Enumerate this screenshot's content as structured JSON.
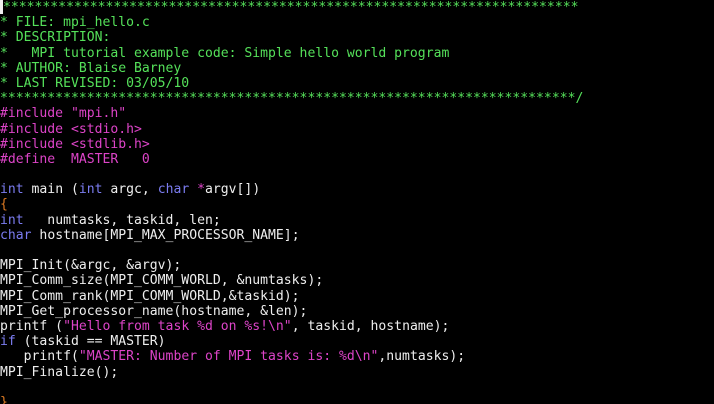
{
  "colors": {
    "background": "#000000",
    "comment": "#55e15a",
    "preprocessor": "#dd44c8",
    "keyword": "#7b7cf0",
    "plain": "#eeeeee",
    "string": "#dd44c8",
    "brace": "#dd7a22",
    "cursor": "#eeeeee"
  },
  "icons": {
    "cursor": "text-cursor-block"
  },
  "editor": {
    "lines": [
      [
        {
          "t": "cursor",
          "s": ""
        },
        {
          "t": "comment",
          "s": "*************************************************************************"
        }
      ],
      [
        {
          "t": "comment",
          "s": "* FILE: mpi_hello.c"
        }
      ],
      [
        {
          "t": "comment",
          "s": "* DESCRIPTION:"
        }
      ],
      [
        {
          "t": "comment",
          "s": "*   MPI tutorial example code: Simple hello world program"
        }
      ],
      [
        {
          "t": "comment",
          "s": "* AUTHOR: Blaise Barney"
        }
      ],
      [
        {
          "t": "comment",
          "s": "* LAST REVISED: 03/05/10"
        }
      ],
      [
        {
          "t": "comment",
          "s": "*************************************************************************/"
        }
      ],
      [
        {
          "t": "preprocessor",
          "s": "#include \"mpi.h\""
        }
      ],
      [
        {
          "t": "preprocessor",
          "s": "#include <stdio.h>"
        }
      ],
      [
        {
          "t": "preprocessor",
          "s": "#include <stdlib.h>"
        }
      ],
      [
        {
          "t": "preprocessor",
          "s": "#define  MASTER   0"
        }
      ],
      [],
      [
        {
          "t": "keyword",
          "s": "int"
        },
        {
          "t": "plain",
          "s": " main ("
        },
        {
          "t": "keyword",
          "s": "int"
        },
        {
          "t": "plain",
          "s": " argc, "
        },
        {
          "t": "keyword",
          "s": "char"
        },
        {
          "t": "plain",
          "s": " "
        },
        {
          "t": "preprocessor",
          "s": "*"
        },
        {
          "t": "plain",
          "s": "argv[])"
        }
      ],
      [
        {
          "t": "brace",
          "s": "{"
        }
      ],
      [
        {
          "t": "keyword",
          "s": "int"
        },
        {
          "t": "plain",
          "s": "   numtasks, taskid, len;"
        }
      ],
      [
        {
          "t": "keyword",
          "s": "char"
        },
        {
          "t": "plain",
          "s": " hostname[MPI_MAX_PROCESSOR_NAME];"
        }
      ],
      [],
      [
        {
          "t": "plain",
          "s": "MPI_Init(&argc, &argv);"
        }
      ],
      [
        {
          "t": "plain",
          "s": "MPI_Comm_size(MPI_COMM_WORLD, &numtasks);"
        }
      ],
      [
        {
          "t": "plain",
          "s": "MPI_Comm_rank(MPI_COMM_WORLD,&taskid);"
        }
      ],
      [
        {
          "t": "plain",
          "s": "MPI_Get_processor_name(hostname, &len);"
        }
      ],
      [
        {
          "t": "plain",
          "s": "printf ("
        },
        {
          "t": "string",
          "s": "\"Hello from task %d on %s!\\n\""
        },
        {
          "t": "plain",
          "s": ", taskid, hostname);"
        }
      ],
      [
        {
          "t": "keyword",
          "s": "if"
        },
        {
          "t": "plain",
          "s": " (taskid == MASTER)"
        }
      ],
      [
        {
          "t": "plain",
          "s": "   printf("
        },
        {
          "t": "string",
          "s": "\"MASTER: Number of MPI tasks is: %d\\n\""
        },
        {
          "t": "plain",
          "s": ",numtasks);"
        }
      ],
      [
        {
          "t": "plain",
          "s": "MPI_Finalize();"
        }
      ],
      [],
      [
        {
          "t": "brace",
          "s": "}"
        }
      ]
    ]
  }
}
